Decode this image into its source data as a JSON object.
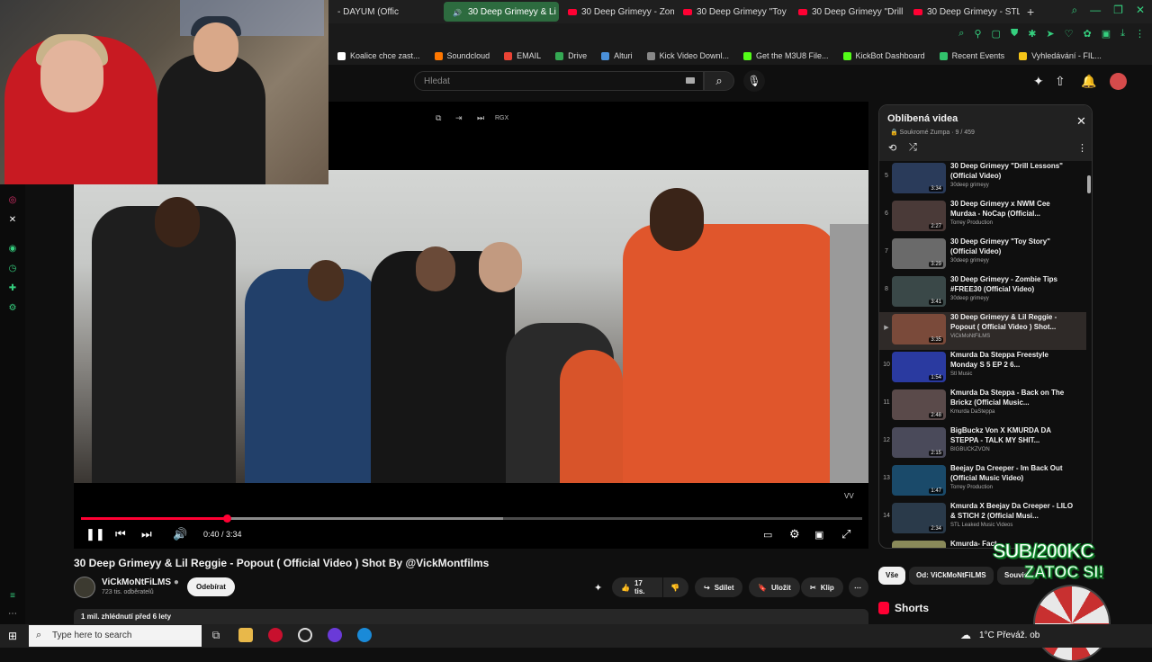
{
  "browser": {
    "tabs": [
      {
        "label": "- DAYUM (Offic",
        "active": false
      },
      {
        "label": "30 Deep Grimeyy & Li",
        "active": true
      },
      {
        "label": "30 Deep Grimeyy - Zomb",
        "active": false
      },
      {
        "label": "30 Deep Grimeyy \"Toy St",
        "active": false
      },
      {
        "label": "30 Deep Grimeyy \"Drill Le",
        "active": false
      },
      {
        "label": "30 Deep Grimeyy - STL B",
        "active": false
      }
    ],
    "new_tab": "+",
    "bookmarks": [
      {
        "label": "Koalice chce zast...",
        "color": "#ffffff"
      },
      {
        "label": "Soundcloud",
        "color": "#ff7700"
      },
      {
        "label": "EMAIL",
        "color": "#ea4335"
      },
      {
        "label": "Drive",
        "color": "#34a853"
      },
      {
        "label": "Alturi",
        "color": "#4a90d9"
      },
      {
        "label": "Kick Video Downl...",
        "color": "#888888"
      },
      {
        "label": "Get the M3U8 File...",
        "color": "#53fc18"
      },
      {
        "label": "KickBot Dashboard",
        "color": "#53fc18"
      },
      {
        "label": "Recent Events",
        "color": "#32c36c"
      },
      {
        "label": "Vyhledávání - FIL...",
        "color": "#f5c518"
      }
    ]
  },
  "header": {
    "search_placeholder": "Hledat"
  },
  "player": {
    "time": "0:40 / 3:34",
    "progress": 0.1869,
    "buffered": 0.54,
    "mini_label": "RGX"
  },
  "video": {
    "title": "30 Deep Grimeyy & Lil Reggie - Popout ( Official Video ) Shot By @VickMontfilms",
    "channel": "ViCkMoNtFiLMS",
    "subscribers": "723 tis. odběratelů",
    "subscribe_label": "Odebírat",
    "likes": "17 tis.",
    "share_label": "Sdílet",
    "save_label": "Uložit",
    "clip_label": "Klip",
    "description_meta": "1 mil. zhlédnutí  před 6 lety"
  },
  "playlist": {
    "title": "Oblíbená videa",
    "subtitle": "Soukromé  Zumpa  ·  9 / 459",
    "items": [
      {
        "num": "5",
        "title": "30 Deep Grimeyy \"Drill Lessons\" (Official Video)",
        "channel": "30deep grimeyy",
        "duration": "3:34",
        "active": false,
        "thumb": "#2a3b5a"
      },
      {
        "num": "6",
        "title": "30 Deep Grimeyy x NWM Cee Murdaa - NoCap (Official...",
        "channel": "Torrey Production",
        "duration": "2:27",
        "active": false,
        "thumb": "#4a3a38"
      },
      {
        "num": "7",
        "title": "30 Deep Grimeyy \"Toy Story\" (Official Video)",
        "channel": "30deep grimeyy",
        "duration": "3:29",
        "active": false,
        "thumb": "#6a6a6a"
      },
      {
        "num": "8",
        "title": "30 Deep Grimeyy - Zombie Tips #FREE30 (Official Video)",
        "channel": "30deep grimeyy",
        "duration": "3:41",
        "active": false,
        "thumb": "#3a4848"
      },
      {
        "num": "▶",
        "title": "30 Deep Grimeyy & Lil Reggie - Popout ( Official Video ) Shot...",
        "channel": "ViCkMoNtFiLMS",
        "duration": "3:35",
        "active": true,
        "thumb": "#7a4a3a"
      },
      {
        "num": "10",
        "title": "Kmurda Da Steppa Freestyle Monday S 5 EP 2 6...",
        "channel": "Stl Music",
        "duration": "1:54",
        "active": false,
        "thumb": "#2a3aa0"
      },
      {
        "num": "11",
        "title": "Kmurda Da Steppa - Back on The Brickz (Official Music...",
        "channel": "Kmurda DaSteppa",
        "duration": "2:48",
        "active": false,
        "thumb": "#5a4a4a"
      },
      {
        "num": "12",
        "title": "BigBuckz Von X KMURDA DA STEPPA - TALK MY SHIT...",
        "channel": "BIGBUCKZVON",
        "duration": "2:15",
        "active": false,
        "thumb": "#4a4a5a"
      },
      {
        "num": "13",
        "title": "Beejay Da Creeper - Im Back Out (Official Music Video)",
        "channel": "Torrey Production",
        "duration": "1:47",
        "active": false,
        "thumb": "#1a4a6a"
      },
      {
        "num": "14",
        "title": "Kmurda X Beejay Da Creeper - LILO & STICH 2 (Official Musi...",
        "channel": "STL Leaked Music Videos",
        "duration": "2:34",
        "active": false,
        "thumb": "#2a3a4a"
      },
      {
        "num": "15",
        "title": "Kmurda- Fact...",
        "channel": "",
        "duration": "",
        "active": false,
        "thumb": "#8a8a5a"
      }
    ]
  },
  "chips": [
    {
      "label": "Vše",
      "selected": true
    },
    {
      "label": "Od: ViCkMoNtFiLMS",
      "selected": false
    },
    {
      "label": "Souvis",
      "selected": false
    }
  ],
  "shorts_label": "Shorts",
  "overlay": {
    "line1": "SUB/200KC",
    "line2": "ZATOC SI!"
  },
  "taskbar": {
    "search_placeholder": "Type here to search",
    "weather": "1°C  Převáž. ob"
  }
}
